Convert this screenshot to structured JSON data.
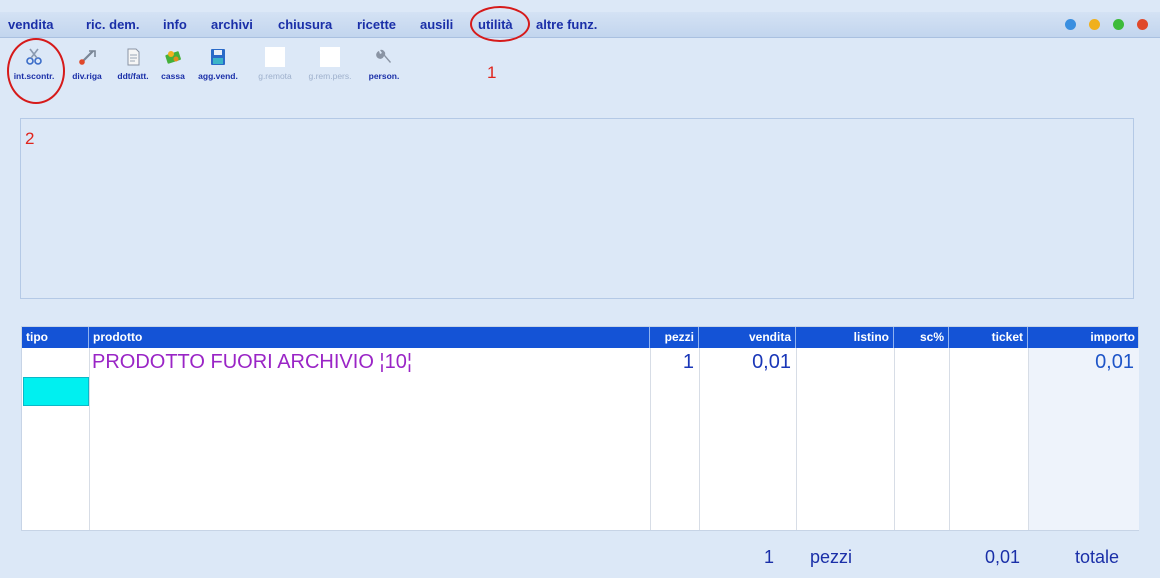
{
  "menu": {
    "items": [
      "vendita",
      "ric. dem.",
      "info",
      "archivi",
      "chiusura",
      "ricette",
      "ausili",
      "utilità",
      "altre funz."
    ],
    "active_index": 7,
    "window_buttons": [
      {
        "name": "minimize",
        "color": "#3a8fe0"
      },
      {
        "name": "restore",
        "color": "#f0b01c"
      },
      {
        "name": "maximize",
        "color": "#3dbb3a"
      },
      {
        "name": "close",
        "color": "#e0482a"
      }
    ]
  },
  "toolbar": {
    "tools": [
      {
        "label": "int.scontr.",
        "icon": "scissors-icon",
        "enabled": true
      },
      {
        "label": "div.riga",
        "icon": "split-row-icon",
        "enabled": true
      },
      {
        "label": "ddt/fatt.",
        "icon": "document-icon",
        "enabled": true
      },
      {
        "label": "cassa",
        "icon": "cash-icon",
        "enabled": true
      },
      {
        "label": "agg.vend.",
        "icon": "save-disk-icon",
        "enabled": true
      },
      {
        "label": "g.remota",
        "icon": "blank-icon",
        "enabled": false
      },
      {
        "label": "g.rem.pers.",
        "icon": "blank-icon",
        "enabled": false
      },
      {
        "label": "person.",
        "icon": "wrench-icon",
        "enabled": true
      }
    ]
  },
  "annotations": {
    "marker_1": "1",
    "marker_2": "2",
    "color": "#e0241c"
  },
  "table": {
    "columns": [
      "tipo",
      "prodotto",
      "pezzi",
      "vendita",
      "listino",
      "sc%",
      "ticket",
      "importo"
    ],
    "rows": [
      {
        "tipo": "",
        "prodotto": "PRODOTTO FUORI ARCHIVIO ¦10¦",
        "pezzi": "1",
        "vendita": "0,01",
        "listino": "",
        "sc": "",
        "ticket": "",
        "importo": "0,01"
      }
    ],
    "header_color": "#1453d6",
    "product_color": "#9a25c6",
    "selection_color": "#00f0f0"
  },
  "footer": {
    "pieces_count": "1",
    "pieces_label": "pezzi",
    "total_value": "0,01",
    "total_label": "totale"
  }
}
